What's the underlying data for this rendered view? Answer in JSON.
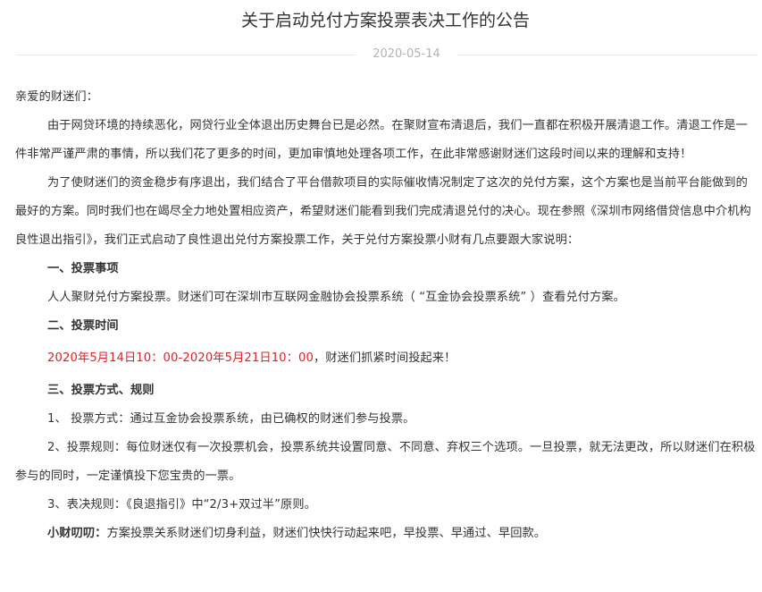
{
  "article": {
    "title": "关于启动兑付方案投票表决工作的公告",
    "date": "2020-05-14",
    "greeting": "亲爱的财迷们：",
    "para1": "由于网贷环境的持续恶化，网贷行业全体退出历史舞台已是必然。在聚财宣布清退后，我们一直都在积极开展清退工作。清退工作是一件非常严谨严肃的事情，所以我们花了更多的时间，更加审慎地处理各项工作，在此非常感谢财迷们这段时间以来的理解和支持！",
    "para2": "为了使财迷们的资金稳步有序退出，我们结合了平台借款项目的实际催收情况制定了这次的兑付方案，这个方案也是当前平台能做到的最好的方案。同时我们也在竭尽全力地处置相应资产，希望财迷们能看到我们完成清退兑付的决心。现在参照《深圳市网络借贷信息中介机构良性退出指引》，我们正式启动了良性退出兑付方案投票工作，关于兑付方案投票小财有几点要跟大家说明：",
    "section1_heading": "一、投票事项",
    "section1_text": "人人聚财兑付方案投票。财迷们可在深圳市互联网金融协会投票系统（ “互金协会投票系统” ）查看兑付方案。",
    "section2_heading": "二、投票时间",
    "section2_time_red": "2020年5月14日10：00-2020年5月21日10：00",
    "section2_time_rest": "，财迷们抓紧时间投起来！",
    "section3_heading": "三、投票方式、规则",
    "item1": "1、 投票方式：通过互金协会投票系统，由已确权的财迷们参与投票。",
    "item2": "2、投票规则：每位财迷仅有一次投票机会，投票系统共设置同意、不同意、弃权三个选项。一旦投票，就无法更改，所以财迷们在积极参与的同时，一定谨慎投下您宝贵的一票。",
    "item3": "3、表决规则：《良退指引》中“2/3+双过半”原则。",
    "reminder_label": "小财叨叨：",
    "reminder_text": "方案投票关系财迷们切身利益，财迷们快快行动起来吧，早投票、早通过、早回款。"
  },
  "colors": {
    "text": "#333333",
    "date": "#b4b4b4",
    "highlight_red": "#d9232c",
    "divider": "#e6e6e6"
  }
}
